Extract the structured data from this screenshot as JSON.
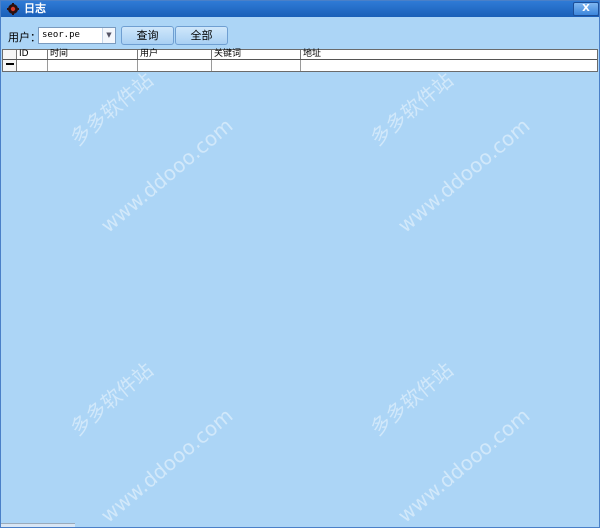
{
  "window": {
    "title": "日志",
    "close_label": "X"
  },
  "toolbar": {
    "user_label": "用户：",
    "user_value": "seor.pe",
    "query_button": "查询",
    "all_button": "全部"
  },
  "grid": {
    "columns": [
      "ID",
      "时间",
      "用户",
      "关键词",
      "地址"
    ]
  },
  "watermarks": [
    "多多软件站",
    "www.ddooo.com",
    "多多软件站",
    "www.ddooo.com",
    "多多软件站",
    "www.ddooo.com",
    "多多软件站",
    "www.ddooo.com"
  ]
}
